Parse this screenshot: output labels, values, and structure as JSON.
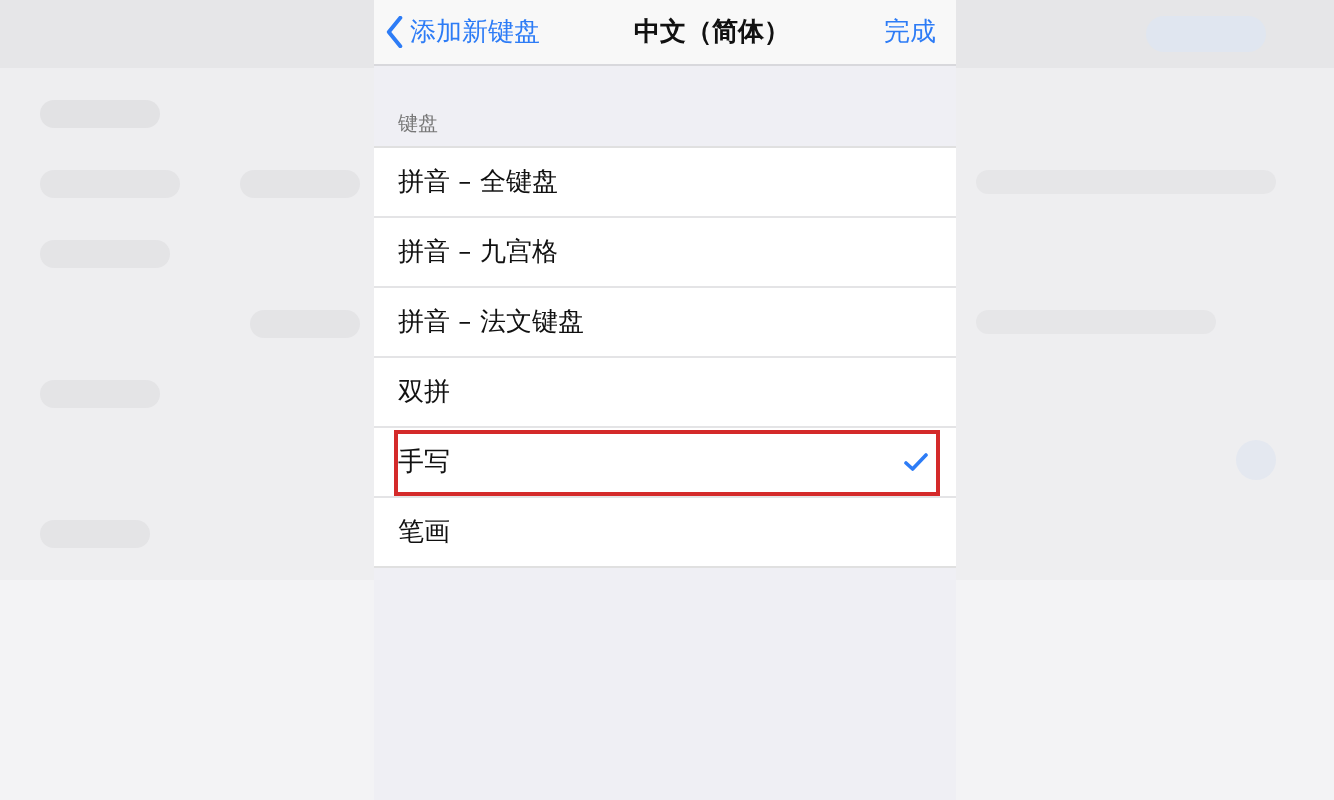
{
  "nav": {
    "back": "添加新键盘",
    "title": "中文（简体）",
    "done": "完成"
  },
  "section": {
    "header": "键盘",
    "items": [
      {
        "label": "拼音 – 全键盘",
        "selected": false,
        "highlighted": false
      },
      {
        "label": "拼音 – 九宫格",
        "selected": false,
        "highlighted": false
      },
      {
        "label": "拼音 – 法文键盘",
        "selected": false,
        "highlighted": false
      },
      {
        "label": "双拼",
        "selected": false,
        "highlighted": false
      },
      {
        "label": "手写",
        "selected": true,
        "highlighted": true
      },
      {
        "label": "笔画",
        "selected": false,
        "highlighted": false
      }
    ]
  }
}
